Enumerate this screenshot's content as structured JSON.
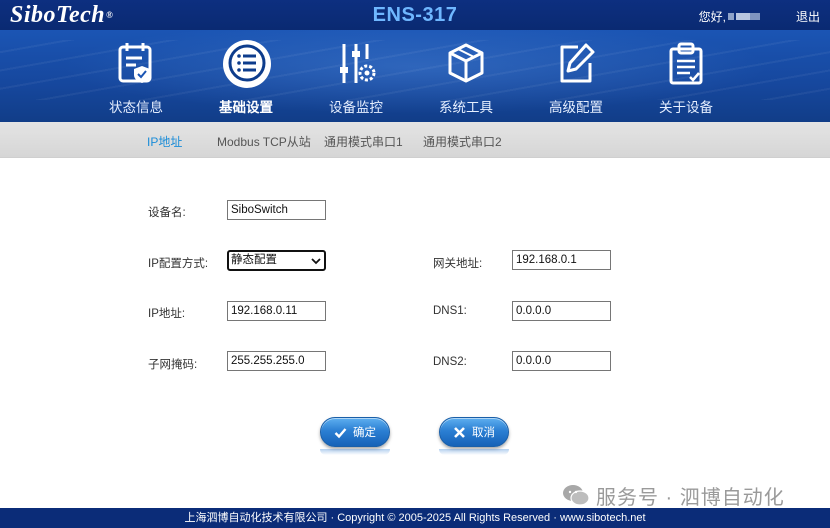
{
  "header": {
    "logo_text": "SiboTech",
    "logo_mark": "®",
    "device_title": "ENS-317",
    "greeting": "您好,",
    "logout": "退出"
  },
  "nav": {
    "items": [
      {
        "label": "状态信息",
        "icon": "status-shield-icon"
      },
      {
        "label": "基础设置",
        "icon": "list-menu-icon",
        "active": true
      },
      {
        "label": "设备监控",
        "icon": "sliders-gear-icon"
      },
      {
        "label": "系统工具",
        "icon": "cube-icon"
      },
      {
        "label": "高级配置",
        "icon": "edit-pen-icon"
      },
      {
        "label": "关于设备",
        "icon": "clipboard-icon"
      }
    ]
  },
  "subtabs": [
    {
      "label": "IP地址",
      "active": true
    },
    {
      "label": "Modbus TCP从站"
    },
    {
      "label": "通用模式串口1"
    },
    {
      "label": "通用模式串口2"
    }
  ],
  "form": {
    "device_name_label": "设备名:",
    "device_name_value": "SiboSwitch",
    "ip_mode_label": "IP配置方式:",
    "ip_mode_value": "静态配置",
    "ip_address_label": "IP地址:",
    "ip_address_value": "192.168.0.11",
    "subnet_label": "子网掩码:",
    "subnet_value": "255.255.255.0",
    "gateway_label": "网关地址:",
    "gateway_value": "192.168.0.1",
    "dns1_label": "DNS1:",
    "dns1_value": "0.0.0.0",
    "dns2_label": "DNS2:",
    "dns2_value": "0.0.0.0"
  },
  "buttons": {
    "confirm": "确定",
    "cancel": "取消"
  },
  "watermark": "服务号 · 泗博自动化",
  "footer": "上海泗博自动化技术有限公司 · Copyright © 2005-2025 All Rights Reserved · www.sibotech.net",
  "colors": {
    "topbar": "#0d2f80",
    "navband": "#1b55b4",
    "active_subtab": "#1a8cd8",
    "button": "#2b7fd3",
    "device_title": "#6fb7ff"
  }
}
